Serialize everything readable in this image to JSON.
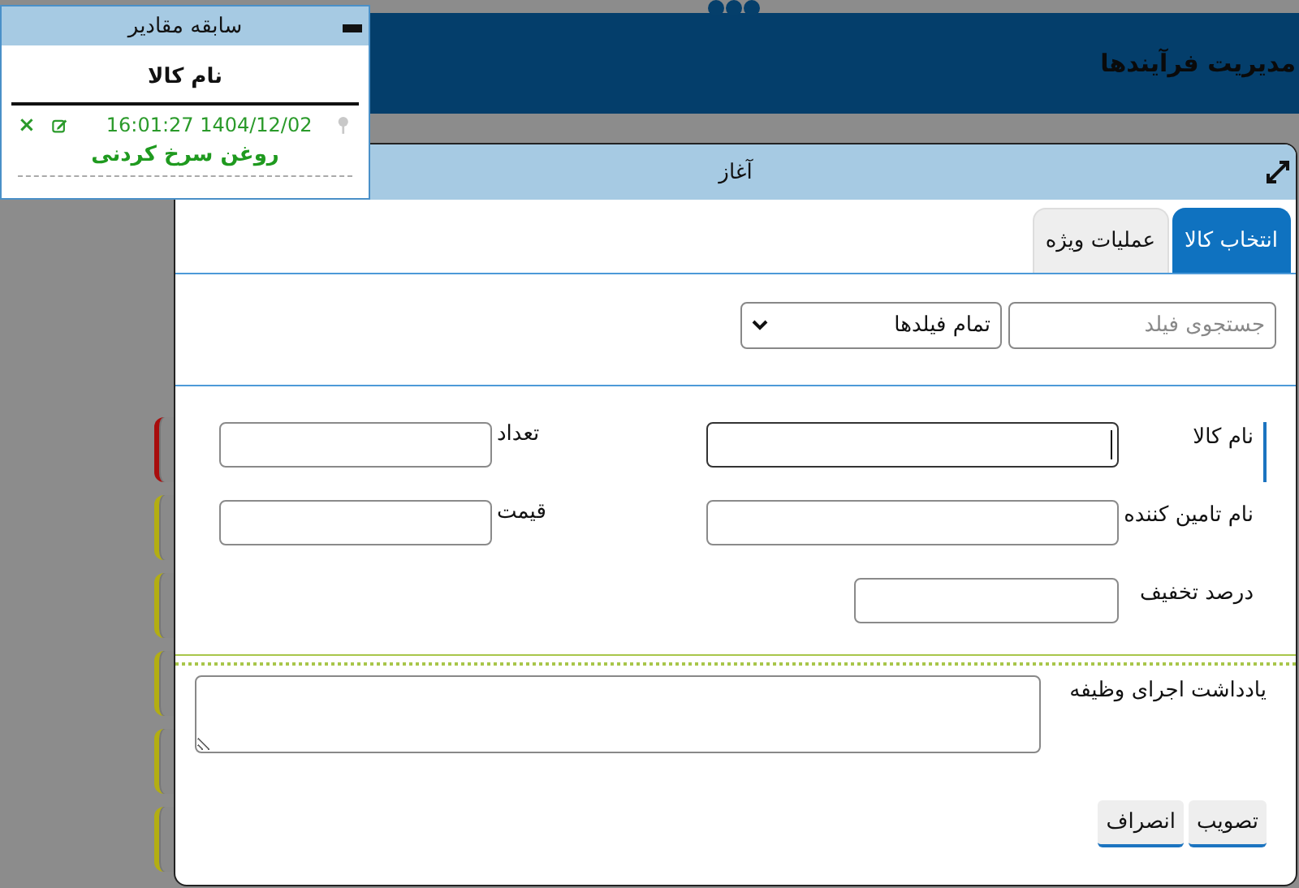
{
  "header": {
    "title": "مدیریت فرآیندها"
  },
  "background_cards": [
    {
      "color": "#a80d0d"
    },
    {
      "color": "#b3ae12"
    },
    {
      "color": "#b3ae12"
    },
    {
      "color": "#b3ae12"
    },
    {
      "color": "#b3ae12"
    },
    {
      "color": "#b3ae12"
    }
  ],
  "history_panel": {
    "title": "سابقه مقادیر",
    "field": "نام کالا",
    "entries": [
      {
        "timestamp": "16:01:27 1404/12/02",
        "delete": "×",
        "value": "روغن سرخ کردنی"
      }
    ]
  },
  "dialog": {
    "title": "آغاز",
    "tabs": [
      {
        "label": "انتخاب کالا",
        "selected": true
      },
      {
        "label": "عملیات ویژه",
        "selected": false
      }
    ],
    "search": {
      "placeholder": "جستجوی فیلد"
    },
    "filter": {
      "value": "تمام فیلدها"
    },
    "field_rows": [
      [
        {
          "label": "نام کالا",
          "focused": true
        },
        {
          "label": "تعداد",
          "focused": false
        }
      ],
      [
        {
          "label": "نام تامین کننده",
          "focused": false
        },
        {
          "label": "قیمت",
          "focused": false
        }
      ],
      [
        {
          "label": "درصد تخفیف",
          "focused": false
        }
      ]
    ],
    "note": {
      "label": "یادداشت اجرای وظیفه"
    },
    "buttons": [
      "تصویب",
      "انصراف"
    ]
  }
}
